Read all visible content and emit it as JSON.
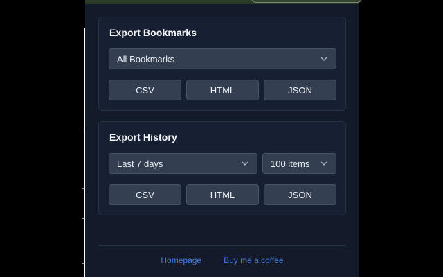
{
  "bookmarks": {
    "title": "Export Bookmarks",
    "scope_select": "All Bookmarks",
    "buttons": [
      "CSV",
      "HTML",
      "JSON"
    ]
  },
  "history": {
    "title": "Export History",
    "range_select": "Last 7 days",
    "count_select": "100 items",
    "buttons": [
      "CSV",
      "HTML",
      "JSON"
    ]
  },
  "footer": {
    "homepage": "Homepage",
    "coffee": "Buy me a coffee"
  },
  "colors": {
    "background": "#131a2a",
    "card": "#172033",
    "control": "#343e51",
    "link": "#3f7fe8"
  },
  "icons": {
    "dropdown": "chevron-down-icon"
  }
}
